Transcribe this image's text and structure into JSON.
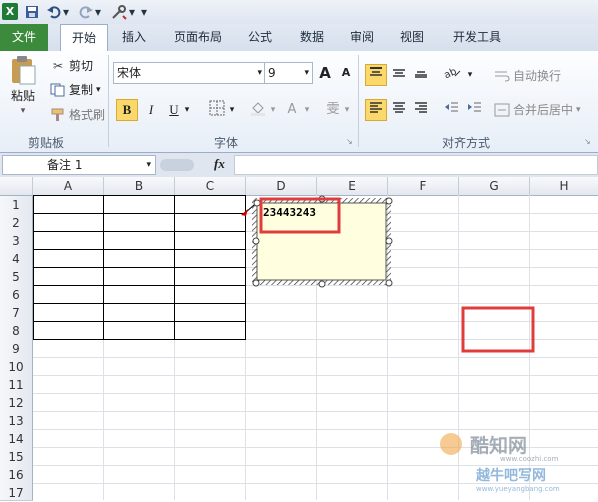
{
  "quick_access": {
    "excel_icon": "excel-logo-icon",
    "save_icon": "save-icon",
    "undo_icon": "undo-icon",
    "redo_icon": "redo-icon",
    "tools_icon": "tools-icon",
    "dropdown_glyph": "▾"
  },
  "tabs": [
    {
      "label": "文件"
    },
    {
      "label": "开始"
    },
    {
      "label": "插入"
    },
    {
      "label": "页面布局"
    },
    {
      "label": "公式"
    },
    {
      "label": "数据"
    },
    {
      "label": "审阅"
    },
    {
      "label": "视图"
    },
    {
      "label": "开发工具"
    }
  ],
  "clipboard": {
    "paste_label": "粘贴",
    "cut_label": "剪切",
    "copy_label": "复制",
    "format_painter_label": "格式刷",
    "group_label": "剪贴板"
  },
  "font": {
    "name": "宋体",
    "size": "9",
    "grow_label": "A",
    "shrink_label": "A",
    "bold": "B",
    "italic": "I",
    "underline": "U",
    "group_label": "字体",
    "phonetic_label": "雯"
  },
  "alignment": {
    "wrap_text_label": "自动换行",
    "merge_label": "合并后居中",
    "group_label": "对齐方式"
  },
  "formula_bar": {
    "name_box": "备注 1",
    "fx": "fx"
  },
  "columns": [
    "A",
    "B",
    "C",
    "D",
    "E",
    "F",
    "G",
    "H"
  ],
  "rows": [
    "1",
    "2",
    "3",
    "4",
    "5",
    "6",
    "7",
    "8",
    "9",
    "10",
    "11",
    "12",
    "13",
    "14",
    "15",
    "16",
    "17"
  ],
  "comment": {
    "text": "23443243"
  },
  "watermark": {
    "line1": "酷知网",
    "line2": "www.coozhi.com",
    "line3": "越牛吧写网",
    "line4": "www.yueyangbang.com"
  },
  "colors": {
    "file_tab": "#3c8b3c",
    "highlight_box": "#e03c3c",
    "comment_bg": "#ffffe0",
    "active_button": "#fbd86b"
  }
}
